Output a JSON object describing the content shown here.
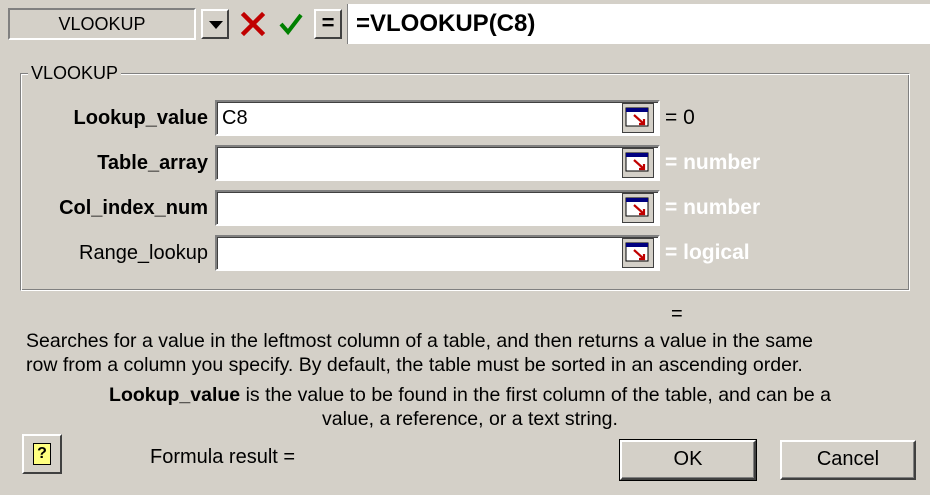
{
  "formula_bar": {
    "name_box": "VLOOKUP",
    "equals_label": "=",
    "formula": "=VLOOKUP(C8)",
    "icons": {
      "dropdown": "chevron-down-icon",
      "cancel": "cross-icon",
      "enter": "checkmark-icon"
    }
  },
  "dialog": {
    "group_title": "VLOOKUP",
    "arguments": [
      {
        "label": "Lookup_value",
        "value": "C8",
        "result_eq": "=",
        "result": "0"
      },
      {
        "label": "Table_array",
        "value": "",
        "result_eq": "=",
        "result": "number"
      },
      {
        "label": "Col_index_num",
        "value": "",
        "result_eq": "=",
        "result": "number"
      },
      {
        "label": "Range_lookup",
        "value": "",
        "result_eq": "=",
        "result": "logical"
      }
    ],
    "function_result_eq": "=",
    "description": [
      "Searches for a value in the leftmost column of a table, and then returns a value in the same",
      "row from a column you specify. By default, the table must be sorted in an ascending order."
    ],
    "arg_description": {
      "name": "Lookup_value",
      "line1": " is the value to be found in the first column of the table, and can be a",
      "line2": "value, a reference, or a text string."
    },
    "formula_result_label": "Formula result =",
    "help_label": "?",
    "ok_label": "OK",
    "cancel_label": "Cancel",
    "colors": {
      "face": "#d4d0c8",
      "cancel_x": "#c00000",
      "enter_check": "#008000",
      "hint_text": "#ffffff"
    }
  }
}
